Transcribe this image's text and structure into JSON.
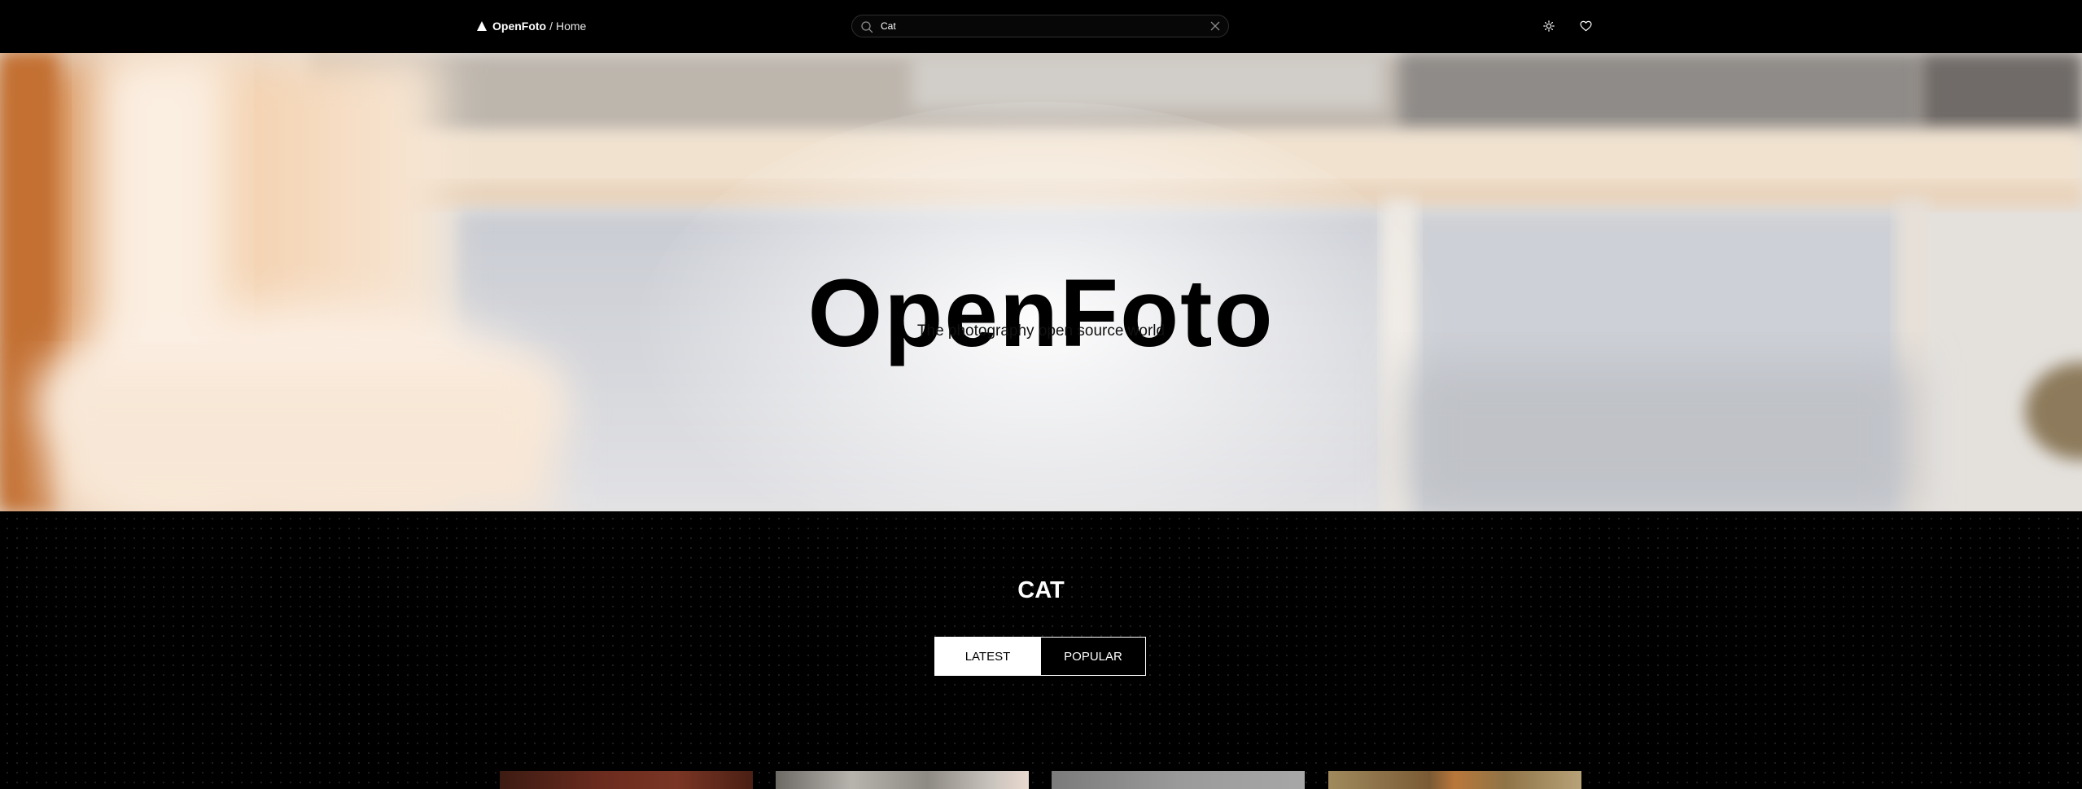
{
  "nav": {
    "brand_name": "OpenFoto",
    "separator": "/",
    "current_page": "Home",
    "logo_icon": "triangle-logo-icon"
  },
  "search": {
    "value": "Cat",
    "placeholder": "Search",
    "icon": "search-icon",
    "clear_icon": "close-icon"
  },
  "actions": {
    "theme_icon": "sun-icon",
    "favorites_icon": "heart-icon"
  },
  "hero": {
    "title": "OpenFoto",
    "subtitle": "The photography open source world"
  },
  "category": {
    "title": "CAT",
    "tabs": [
      {
        "label": "LATEST",
        "active": true
      },
      {
        "label": "POPULAR",
        "active": false
      }
    ]
  },
  "colors": {
    "background": "#000000",
    "text_light": "#ffffff",
    "text_dark": "#000000"
  }
}
